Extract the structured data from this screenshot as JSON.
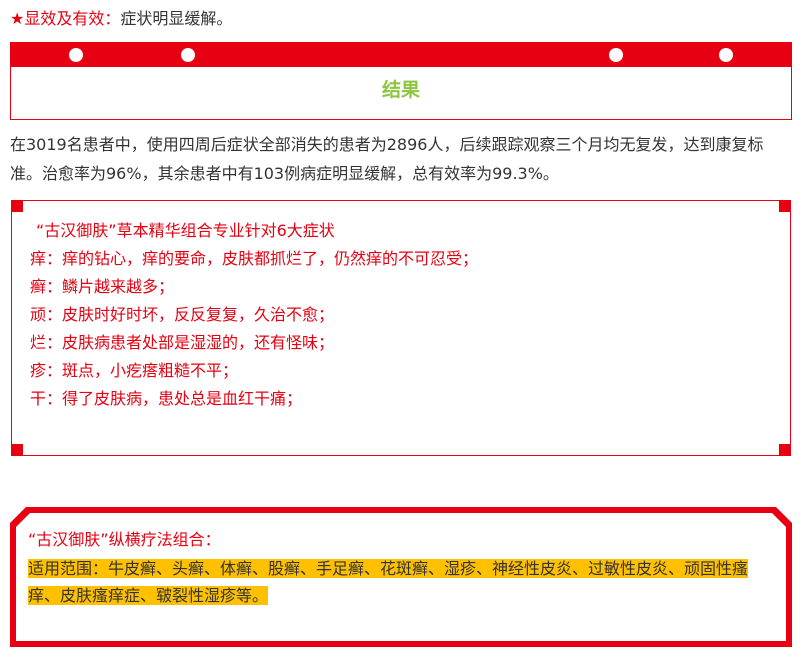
{
  "effect_line": {
    "star": "★",
    "label": "显效及有效：",
    "text": "症状明显缓解。"
  },
  "result_banner": {
    "title": "结果"
  },
  "result_paragraph": "在3019名患者中，使用四周后症状全部消失的患者为2896人，后续跟踪观察三个月均无复发，达到康复标准。治愈率为96%，其余患者中有103例病症明显缓解，总有效率为99.3%。",
  "symptoms_box": {
    "title": "“古汉御肤”草本精华组合专业针对6大症状",
    "items": [
      "痒：痒的钻心，痒的要命，皮肤都抓烂了，仍然痒的不可忍受；",
      "癣：鳞片越来越多；",
      "顽：皮肤时好时坏，反反复复，久治不愈；",
      "烂：皮肤病患者处部是湿湿的，还有怪味；",
      "疹：斑点，小疙瘩粗糙不平；",
      "干：得了皮肤病，患处总是血红干痛；"
    ]
  },
  "treatment_box": {
    "title": "“古汉御肤”纵横疗法组合：",
    "scope": "适用范围：牛皮癣、头癣、体癣、股癣、手足癣、花斑癣、湿疹、神经性皮炎、过敏性皮炎、顽固性瘙痒、皮肤瘙痒症、皲裂性湿疹等。"
  },
  "colors": {
    "accent_red": "#e60012",
    "title_green": "#8cc63f",
    "highlight_yellow": "#ffc000"
  }
}
